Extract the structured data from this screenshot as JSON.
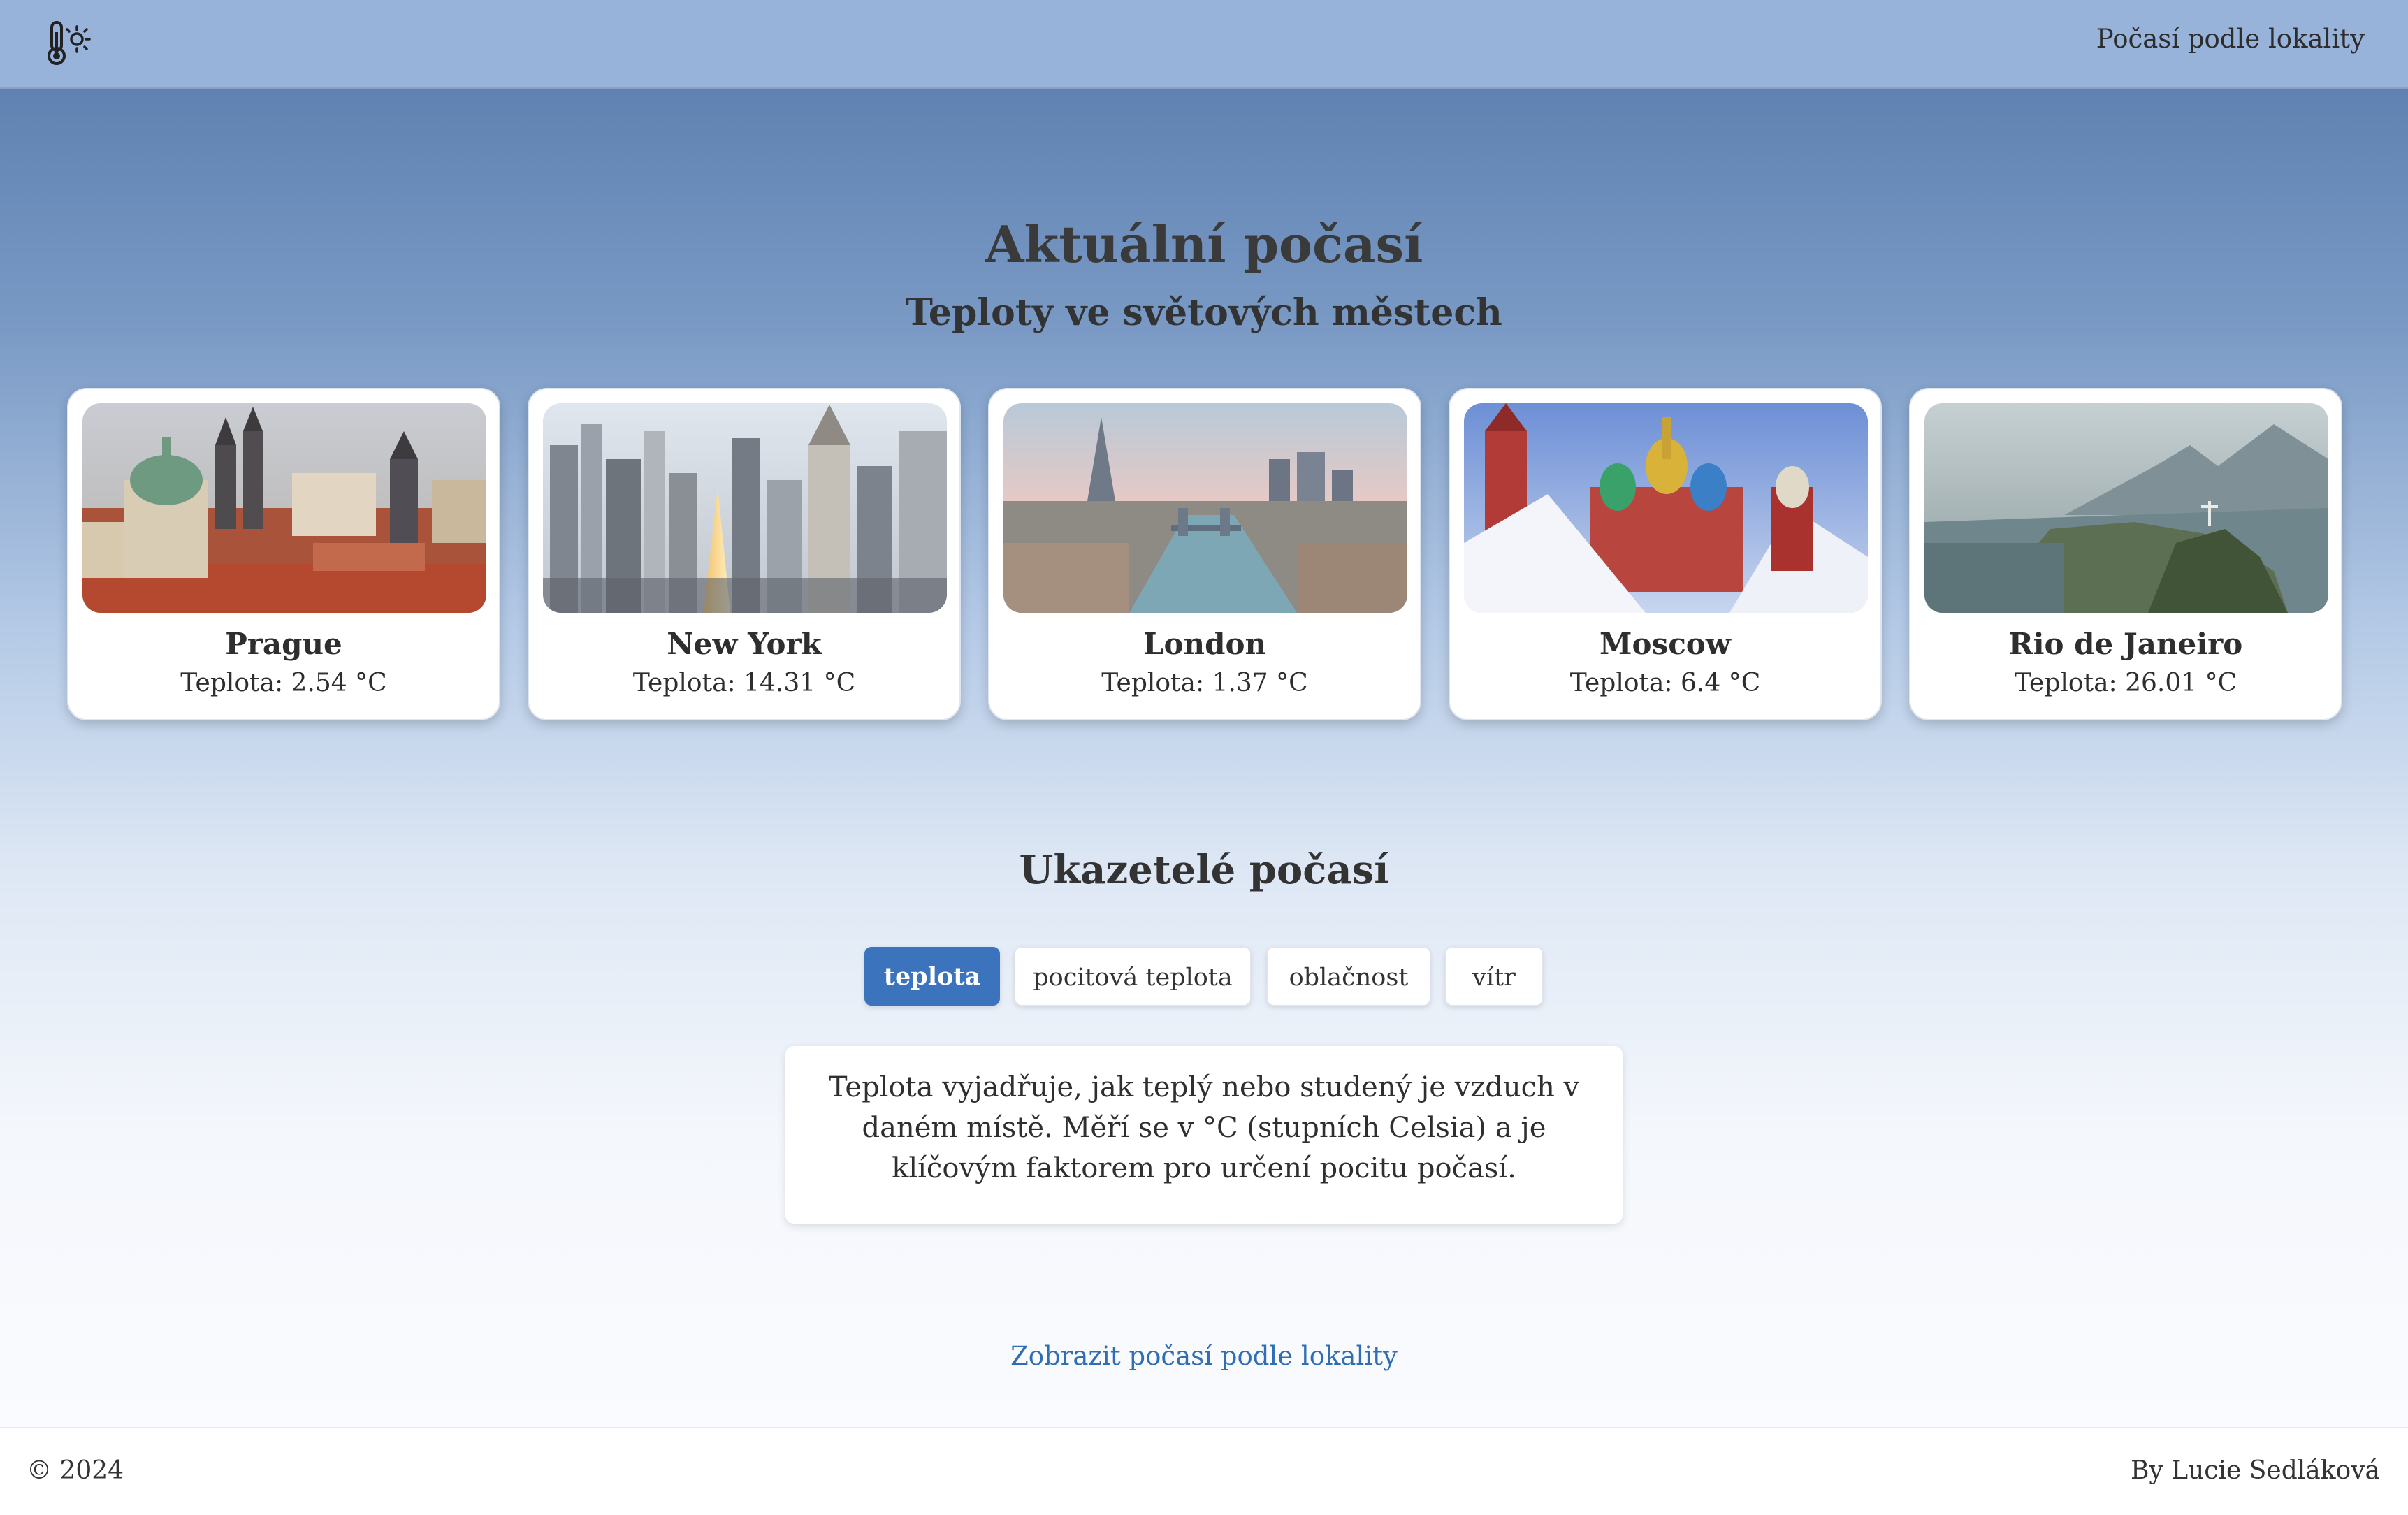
{
  "header": {
    "logo_icon": "thermometer-sun-icon",
    "nav_link": "Počasí podle lokality"
  },
  "hero": {
    "title": "Aktuální počasí",
    "subtitle": "Teploty ve světových městech"
  },
  "cities": [
    {
      "name": "Prague",
      "temp": "Teplota: 2.54 °C"
    },
    {
      "name": "New York",
      "temp": "Teplota: 14.31 °C"
    },
    {
      "name": "London",
      "temp": "Teplota: 1.37 °C"
    },
    {
      "name": "Moscow",
      "temp": "Teplota: 6.4 °C"
    },
    {
      "name": "Rio de Janeiro",
      "temp": "Teplota: 26.01 °C"
    }
  ],
  "indicators": {
    "title": "Ukazetelé počasí",
    "tabs": [
      "teplota",
      "pocitová teplota",
      "oblačnost",
      "vítr"
    ],
    "active_tab": "teplota",
    "description": "Teplota vyjadřuje, jak teplý nebo studený je vzduch v daném místě. Měří se v °C (stupních Celsia) a je klíčovým faktorem pro určení pocitu počasí.",
    "link": "Zobrazit počasí podle lokality"
  },
  "footer": {
    "copyright": "© 2024",
    "author": "By Lucie Sedláková"
  },
  "colors": {
    "header_bg": "#98b3da",
    "accent": "#3b73bc",
    "link": "#2f6db5"
  }
}
